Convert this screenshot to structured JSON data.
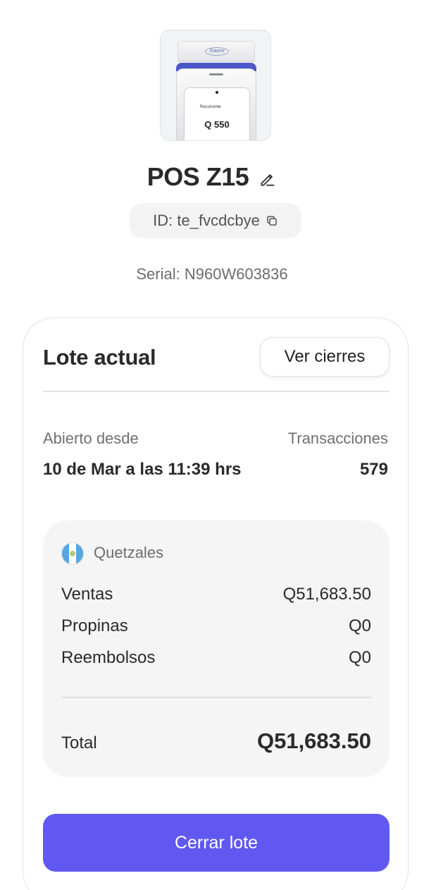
{
  "device": {
    "image_brand": "Xiaomi",
    "image_screen_label": "Recurrente",
    "image_screen_amount": "Q 550",
    "name": "POS Z15",
    "id_text": "ID: te_fvcdcbye",
    "serial_text": "Serial: N960W603836"
  },
  "batch": {
    "title": "Lote actual",
    "view_closures_label": "Ver cierres",
    "opened_since_label": "Abierto desde",
    "opened_since_value": "10 de Mar a las 11:39 hrs",
    "transactions_label": "Transacciones",
    "transactions_value": "579",
    "currency": {
      "name": "Quetzales",
      "flag_icon": "guatemala-flag-icon",
      "rows": [
        {
          "label": "Ventas",
          "value": "Q51,683.50"
        },
        {
          "label": "Propinas",
          "value": "Q0"
        },
        {
          "label": "Reembolsos",
          "value": "Q0"
        }
      ],
      "total_label": "Total",
      "total_value": "Q51,683.50"
    },
    "close_button_label": "Cerrar lote"
  },
  "colors": {
    "accent": "#6158f2",
    "card_border": "#e4e4e4",
    "panel_bg": "#f5f5f5"
  }
}
